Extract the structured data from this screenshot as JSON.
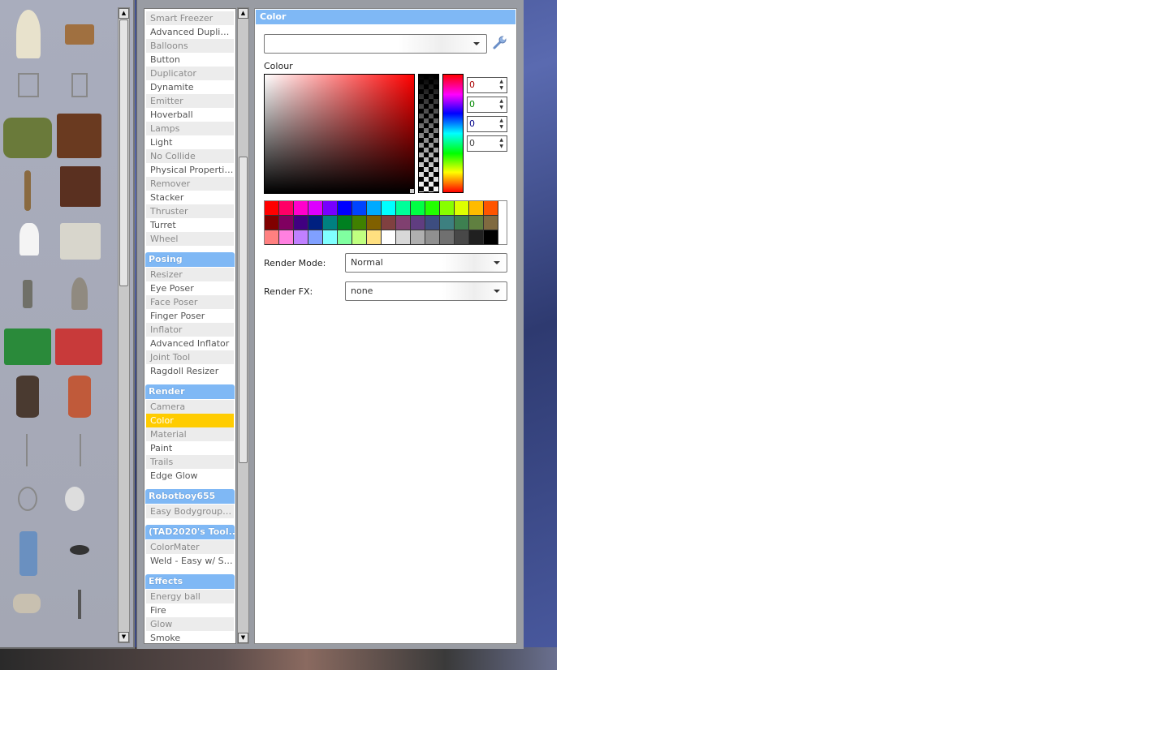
{
  "tool_categories": [
    {
      "header": null,
      "items": [
        "Smart Freezer",
        "Advanced Duplicat…",
        "Balloons",
        "Button",
        "Duplicator",
        "Dynamite",
        "Emitter",
        "Hoverball",
        "Lamps",
        "Light",
        "No Collide",
        "Physical Properties",
        "Remover",
        "Stacker",
        "Thruster",
        "Turret",
        "Wheel"
      ]
    },
    {
      "header": "Posing",
      "items": [
        "Resizer",
        "Eye Poser",
        "Face Poser",
        "Finger Poser",
        "Inflator",
        "Advanced Inflator",
        "Joint Tool",
        "Ragdoll Resizer"
      ]
    },
    {
      "header": "Render",
      "items": [
        "Camera",
        "Color",
        "Material",
        "Paint",
        "Trails",
        "Edge Glow"
      ],
      "selected": "Color"
    },
    {
      "header": "Robotboy655",
      "items": [
        "Easy Bodygroup Tool"
      ]
    },
    {
      "header": "(TAD2020's Tool...",
      "items": [
        "ColorMater",
        "Weld - Easy w/ Sna…"
      ]
    },
    {
      "header": "Effects",
      "items": [
        "Energy ball",
        "Fire",
        "Glow",
        "Smoke"
      ]
    }
  ],
  "color_panel": {
    "title": "Color",
    "preset_combo": "",
    "colour_label": "Colour",
    "rgba": {
      "r": "0",
      "g": "0",
      "b": "0",
      "a": "0"
    },
    "render_mode_label": "Render Mode:",
    "render_mode_value": "Normal",
    "render_fx_label": "Render FX:",
    "render_fx_value": "none"
  },
  "palette": [
    "#ff0000",
    "#ff0066",
    "#ff00cc",
    "#dd00ff",
    "#7700ff",
    "#0000ff",
    "#0044ff",
    "#00aaff",
    "#00ffff",
    "#00ff99",
    "#00ff44",
    "#22ff00",
    "#88ff00",
    "#ddff00",
    "#ffbb00",
    "#ff5500",
    "#800000",
    "#800060",
    "#400080",
    "#002080",
    "#008080",
    "#008020",
    "#408000",
    "#806000",
    "#804040",
    "#804070",
    "#603d80",
    "#3d4d80",
    "#3d8080",
    "#3d8050",
    "#608040",
    "#806a40",
    "#ff8080",
    "#ff80e0",
    "#c080ff",
    "#80a0ff",
    "#80ffff",
    "#80ffa0",
    "#c0ff80",
    "#ffe080",
    "#ffffff",
    "#d8d8d8",
    "#b0b0b0",
    "#909090",
    "#707070",
    "#484848",
    "#202020",
    "#000000"
  ],
  "accent": "#7fb8f5",
  "selected_color": "#ffcc00"
}
